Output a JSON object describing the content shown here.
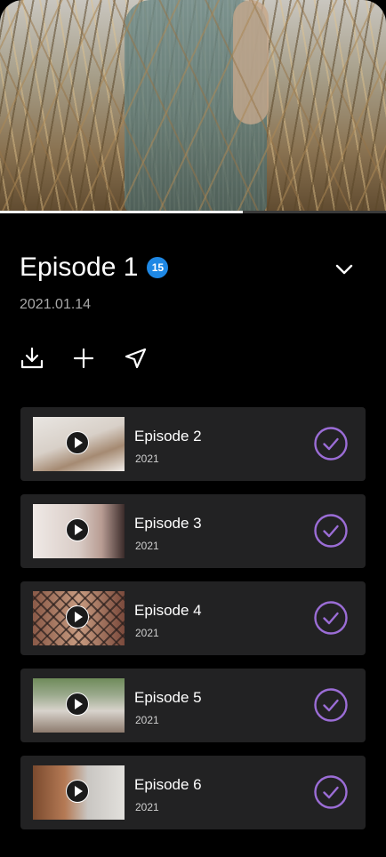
{
  "player": {
    "progress_percent": 63
  },
  "episode": {
    "title": "Episode 1",
    "badge": "15",
    "date": "2021.01.14"
  },
  "icons": {
    "collapse": "chevron-down-icon",
    "download": "download-icon",
    "add": "plus-icon",
    "share": "send-icon"
  },
  "colors": {
    "background": "#000000",
    "card": "#222223",
    "badge": "#1e88e5",
    "check": "#9b6dd6"
  },
  "episodes": [
    {
      "title": "Episode 2",
      "year": "2021"
    },
    {
      "title": "Episode 3",
      "year": "2021"
    },
    {
      "title": "Episode 4",
      "year": "2021"
    },
    {
      "title": "Episode 5",
      "year": "2021"
    },
    {
      "title": "Episode 6",
      "year": "2021"
    }
  ]
}
